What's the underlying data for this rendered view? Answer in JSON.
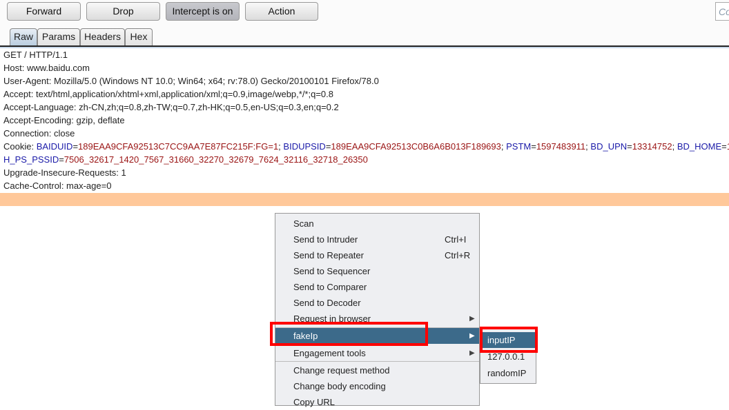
{
  "toolbar": {
    "forward": "Forward",
    "drop": "Drop",
    "intercept": "Intercept is on",
    "action": "Action",
    "search_placeholder": "Co"
  },
  "tabs": [
    "Raw",
    "Params",
    "Headers",
    "Hex"
  ],
  "request": {
    "lines": [
      "GET / HTTP/1.1",
      "Host: www.baidu.com",
      "User-Agent: Mozilla/5.0 (Windows NT 10.0; Win64; x64; rv:78.0) Gecko/20100101 Firefox/78.0",
      "Accept: text/html,application/xhtml+xml,application/xml;q=0.9,image/webp,*/*;q=0.8",
      "Accept-Language: zh-CN,zh;q=0.8,zh-TW;q=0.7,zh-HK;q=0.5,en-US;q=0.3,en;q=0.2",
      "Accept-Encoding: gzip, deflate",
      "Connection: close"
    ],
    "cookie_label": "Cookie: ",
    "cookies": [
      {
        "k": "BAIDUID",
        "v": "189EAA9CFA92513C7CC9AA7E87FC215F:FG=1"
      },
      {
        "k": "BIDUPSID",
        "v": "189EAA9CFA92513C0B6A6B013F189693"
      },
      {
        "k": "PSTM",
        "v": "1597483911"
      },
      {
        "k": "BD_UPN",
        "v": "13314752"
      },
      {
        "k": "BD_HOME",
        "v": "1"
      }
    ],
    "cookie2": {
      "k": "H_PS_PSSID",
      "v": "7506_32617_1420_7567_31660_32270_32679_7624_32116_32718_26350"
    },
    "lines2": [
      "Upgrade-Insecure-Requests: 1",
      "Cache-Control: max-age=0"
    ]
  },
  "menu": [
    {
      "label": "Scan"
    },
    {
      "label": "Send to Intruder",
      "shortcut": "Ctrl+I"
    },
    {
      "label": "Send to Repeater",
      "shortcut": "Ctrl+R"
    },
    {
      "label": "Send to Sequencer"
    },
    {
      "label": "Send to Comparer"
    },
    {
      "label": "Send to Decoder"
    },
    {
      "label": "Request in browser",
      "submenu": true
    },
    {
      "label": "fakeIp",
      "submenu": true,
      "selected": true
    },
    {
      "label": "Engagement tools",
      "submenu": true
    },
    {
      "label": "Change request method"
    },
    {
      "label": "Change body encoding"
    },
    {
      "label": "Copy URL"
    }
  ],
  "submenu": [
    {
      "label": "inputIP",
      "selected": true
    },
    {
      "label": "127.0.0.1"
    },
    {
      "label": "randomIP"
    }
  ],
  "colors": {
    "highlight": "#ffc89a",
    "selected": "#3c6a8a",
    "annotation": "#ff0000"
  }
}
